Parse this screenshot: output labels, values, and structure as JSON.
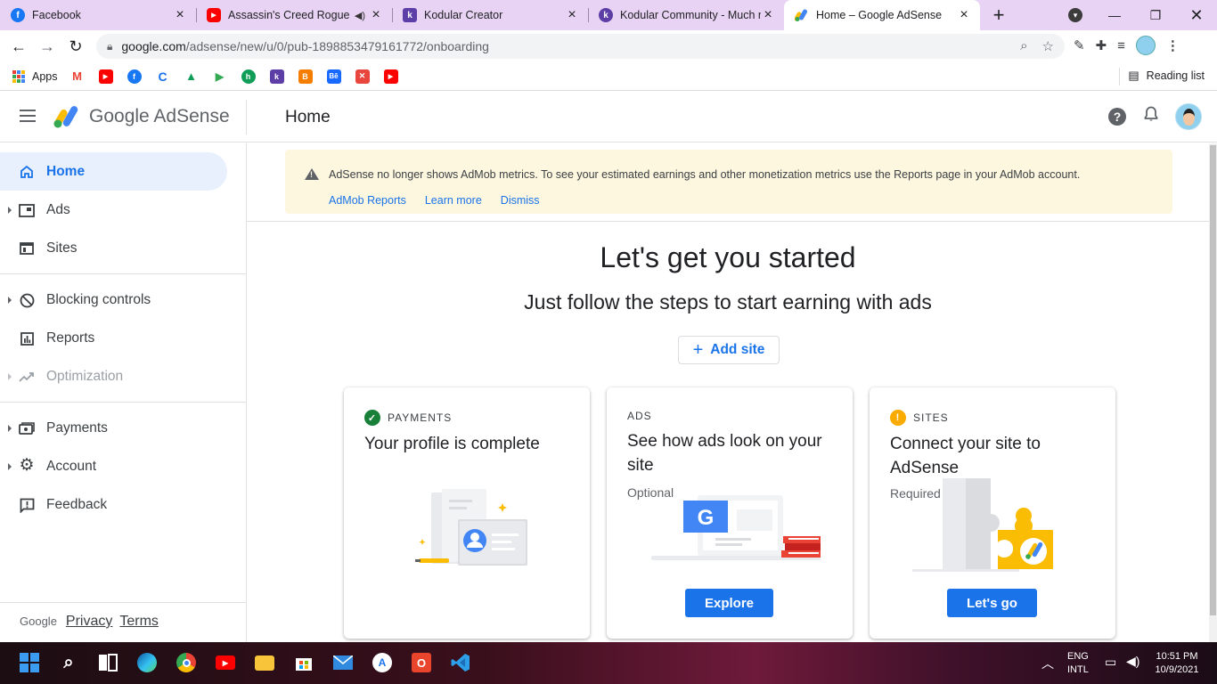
{
  "browser": {
    "tabs": [
      {
        "title": "Facebook",
        "favicon": "facebook-icon",
        "color": "#1877f2",
        "glyph": "f"
      },
      {
        "title": "Assassin's Creed Rogue (",
        "favicon": "youtube-icon",
        "color": "#ff0000",
        "glyph": "▶",
        "audio": true
      },
      {
        "title": "Kodular Creator",
        "favicon": "kodular-icon",
        "color": "#5c3ea6",
        "glyph": "k"
      },
      {
        "title": "Kodular Community - Much m",
        "favicon": "kodular-icon",
        "color": "#5c3ea6",
        "glyph": "k"
      },
      {
        "title": "Home – Google AdSense",
        "favicon": "adsense-icon",
        "color": "#fbbc04",
        "glyph": "",
        "active": true
      }
    ],
    "url_host": "google.com",
    "url_path": "/adsense/new/u/0/pub-1898853479161772/onboarding",
    "bookmarks": {
      "apps_label": "Apps",
      "icons": [
        {
          "name": "gmail-bookmark-icon",
          "color": "#ea4335",
          "glyph": "M"
        },
        {
          "name": "youtube-bookmark-icon",
          "color": "#ff0000",
          "glyph": "▶"
        },
        {
          "name": "facebook-bookmark-icon",
          "color": "#1877f2",
          "glyph": "f"
        },
        {
          "name": "c-bookmark-icon",
          "color": "#1a73e8",
          "glyph": "C"
        },
        {
          "name": "drive-bookmark-icon",
          "color": "#0f9d58",
          "glyph": "▲"
        },
        {
          "name": "play-bookmark-icon",
          "color": "#34a853",
          "glyph": "▶"
        },
        {
          "name": "green-app-bookmark-icon",
          "color": "#0f9d58",
          "glyph": "ĥ"
        },
        {
          "name": "kodular-bookmark-icon",
          "color": "#5c3ea6",
          "glyph": "k"
        },
        {
          "name": "blogger-bookmark-icon",
          "color": "#f57d00",
          "glyph": "B"
        },
        {
          "name": "behance-bookmark-icon",
          "color": "#1769ff",
          "glyph": "Bē"
        },
        {
          "name": "tools-bookmark-icon",
          "color": "#e8453c",
          "glyph": "✕"
        },
        {
          "name": "youtube2-bookmark-icon",
          "color": "#ff0000",
          "glyph": "▶"
        }
      ],
      "reading_list": "Reading list"
    }
  },
  "adsense": {
    "brand": "Google AdSense",
    "page_title": "Home",
    "nav": [
      {
        "label": "Home",
        "icon": "home-icon",
        "glyph": "⌂",
        "active": true,
        "caret": false
      },
      {
        "label": "Ads",
        "icon": "ads-icon",
        "glyph": "▣",
        "caret": true
      },
      {
        "label": "Sites",
        "icon": "sites-icon",
        "glyph": "▤",
        "caret": false
      },
      {
        "label": "Blocking controls",
        "icon": "block-icon",
        "glyph": "⊘",
        "caret": true
      },
      {
        "label": "Reports",
        "icon": "reports-icon",
        "glyph": "▥",
        "caret": false
      },
      {
        "label": "Optimization",
        "icon": "trending-icon",
        "glyph": "↗",
        "caret": true,
        "disabled": true
      },
      {
        "label": "Payments",
        "icon": "payments-icon",
        "glyph": "▭",
        "caret": true
      },
      {
        "label": "Account",
        "icon": "gear-icon",
        "glyph": "⚙",
        "caret": true
      },
      {
        "label": "Feedback",
        "icon": "feedback-icon",
        "glyph": "!",
        "caret": false
      }
    ],
    "footer": {
      "google": "Google",
      "privacy": "Privacy",
      "terms": "Terms"
    },
    "notice": {
      "text": "AdSense no longer shows AdMob metrics. To see your estimated earnings and other monetization metrics use the Reports page in your AdMob account.",
      "links": [
        "AdMob Reports",
        "Learn more",
        "Dismiss"
      ]
    },
    "hero": {
      "title": "Let's get you started",
      "subtitle": "Just follow the steps to start earning with ads",
      "add_site": "Add site"
    },
    "cards": [
      {
        "tag": "PAYMENTS",
        "title": "Your profile is complete",
        "status": "complete",
        "status_color": "#188038"
      },
      {
        "tag": "ADS",
        "title": "See how ads look on your site",
        "sub": "Optional",
        "button": "Explore"
      },
      {
        "tag": "SITES",
        "title": "Connect your site to AdSense",
        "sub": "Required",
        "button": "Let's go",
        "status": "required",
        "status_color": "#f9ab00"
      }
    ]
  },
  "taskbar": {
    "lang_top": "ENG",
    "lang_bottom": "INTL",
    "time": "10:51 PM",
    "date": "10/9/2021"
  }
}
